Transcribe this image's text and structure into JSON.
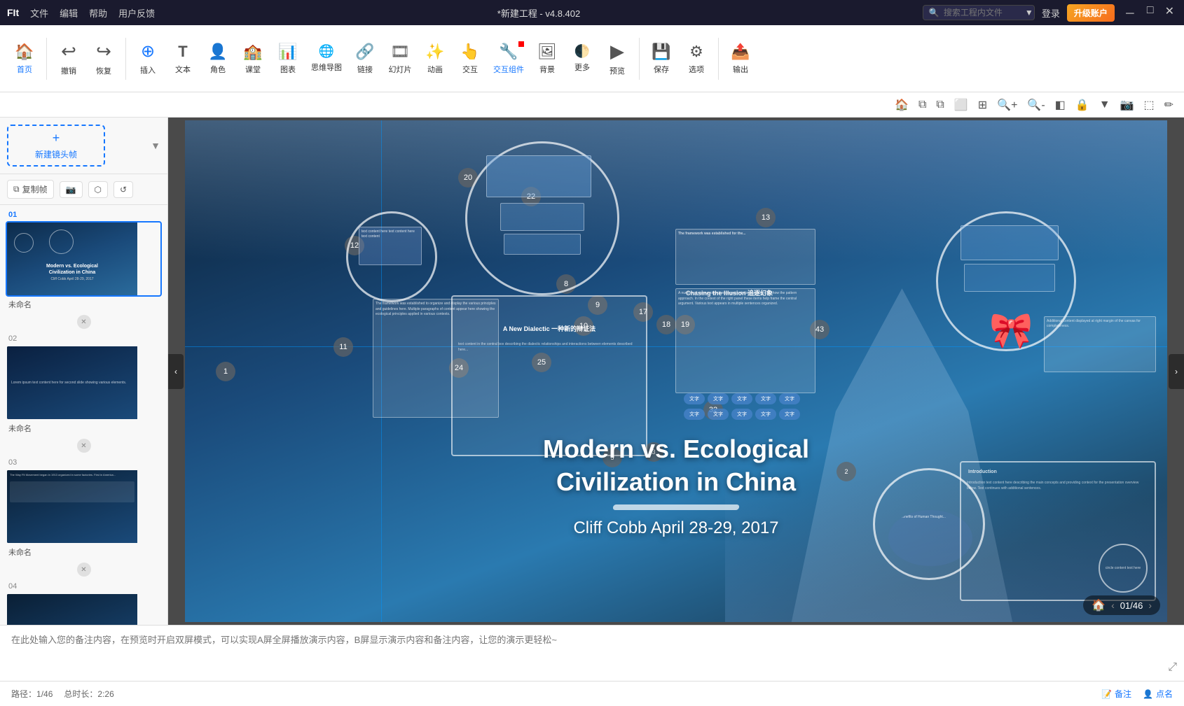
{
  "app": {
    "logo": "FIt",
    "title": "*新建工程 - v4.8.402",
    "menu": [
      "文件",
      "编辑",
      "帮助",
      "用户反馈"
    ],
    "search_placeholder": "搜索工程内文件",
    "login": "登录",
    "upgrade": "升级账户",
    "win_controls": [
      "－",
      "□",
      "✕"
    ]
  },
  "toolbar": {
    "groups": [
      {
        "id": "home",
        "icon": "🏠",
        "label": "首页",
        "active": true
      },
      {
        "id": "undo",
        "icon": "↩",
        "label": "撤销"
      },
      {
        "id": "redo",
        "icon": "↪",
        "label": "恢复"
      },
      {
        "id": "insert",
        "icon": "⊕",
        "label": "插入"
      },
      {
        "id": "text",
        "icon": "T",
        "label": "文本"
      },
      {
        "id": "role",
        "icon": "👤",
        "label": "角色"
      },
      {
        "id": "classroom",
        "icon": "🏫",
        "label": "课堂"
      },
      {
        "id": "chart",
        "icon": "📊",
        "label": "图表"
      },
      {
        "id": "mindmap",
        "icon": "🧠",
        "label": "思维导图"
      },
      {
        "id": "link",
        "icon": "🔗",
        "label": "链接"
      },
      {
        "id": "slide",
        "icon": "🎞",
        "label": "幻灯片"
      },
      {
        "id": "animation",
        "icon": "✨",
        "label": "动画"
      },
      {
        "id": "interact",
        "icon": "👆",
        "label": "交互"
      },
      {
        "id": "interact-component",
        "icon": "🔧",
        "label": "交互组件",
        "active": true
      },
      {
        "id": "background",
        "icon": "🖼",
        "label": "背景"
      },
      {
        "id": "shadow",
        "icon": "🌓",
        "label": "更多"
      },
      {
        "id": "preview",
        "icon": "▶",
        "label": "预览"
      },
      {
        "id": "save",
        "icon": "💾",
        "label": "保存"
      },
      {
        "id": "settings",
        "icon": "⚙",
        "label": "选项"
      },
      {
        "id": "export",
        "icon": "📤",
        "label": "输出"
      }
    ]
  },
  "secondary_toolbar": {
    "tools": [
      "🏠",
      "⧉",
      "⧉",
      "⬜",
      "⧉",
      "🔍+",
      "🔍-",
      "◧",
      "🔒",
      "▼",
      "📷",
      "⬚",
      "✏"
    ]
  },
  "sidebar": {
    "new_frame_label": "新建镜头帧",
    "frame_actions": [
      "复制帧",
      "📷",
      "⬡",
      "↺"
    ],
    "slides": [
      {
        "num": "01",
        "label": "未命名",
        "active": true,
        "thumb_title": "Modern vs. Ecological Civilization in China",
        "thumb_subtitle": "Cliff Cobb  April 28-29, 2017"
      },
      {
        "num": "02",
        "label": "未命名",
        "active": false
      },
      {
        "num": "03",
        "label": "未命名",
        "active": false
      },
      {
        "num": "04",
        "label": "",
        "active": false
      }
    ]
  },
  "canvas": {
    "main_title_line1": "Modern vs. Ecological",
    "main_title_line2": "Civilization in China",
    "subtitle": "Cliff Cobb  April 28-29, 2017",
    "page_current": "01",
    "page_total": "46",
    "nav_numbers": [
      "20",
      "22",
      "12",
      "8",
      "9",
      "10",
      "17",
      "18",
      "19",
      "11",
      "1",
      "24",
      "25",
      "32",
      "43",
      "13",
      "2",
      "3",
      "5"
    ],
    "elements": [
      {
        "type": "circle",
        "label": "circle-1"
      },
      {
        "type": "box",
        "label": "box-1"
      },
      {
        "type": "ribbon",
        "label": "ribbon"
      }
    ]
  },
  "note_area": {
    "placeholder": "在此处输入您的备注内容，在预览时开启双屏模式，可以实现A屏全屏播放演示内容，B屏显示演示内容和备注内容，让您的演示更轻松~"
  },
  "statusbar": {
    "path_label": "路径：",
    "path_value": "1/46",
    "total_label": "总时长：",
    "total_value": "2:26",
    "note_btn": "备注",
    "point_btn": "点名"
  }
}
